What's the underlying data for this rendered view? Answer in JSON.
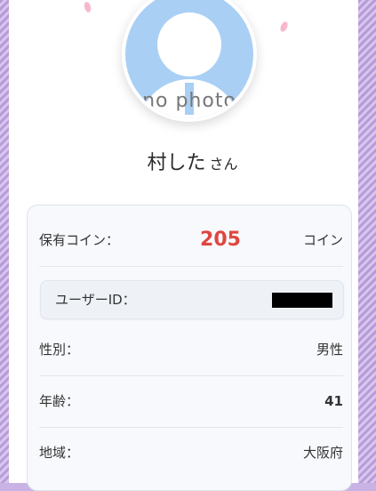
{
  "profile": {
    "avatar_text": "no photo",
    "name": "村した",
    "honorific": "さん"
  },
  "info": {
    "coins_label": "保有コイン：",
    "coins_value": "205",
    "coins_unit": "コイン",
    "user_id_label": "ユーザーID：",
    "gender_label": "性別：",
    "gender_value": "男性",
    "age_label": "年齢：",
    "age_value": "41",
    "region_label": "地域：",
    "region_value": "大阪府"
  },
  "colors": {
    "coins": "#e0463f",
    "avatar_bg": "#a9cff4",
    "background": "#c9b3e4"
  }
}
